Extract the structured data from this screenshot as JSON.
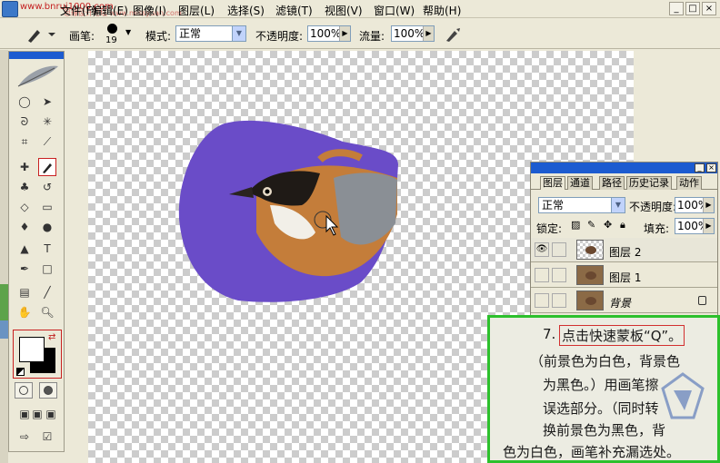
{
  "watermark": "www.bnrui1000.com",
  "watermark_sub": "思缘设计论坛 www.missyuan.com",
  "menus": [
    "文件(F)",
    "编辑(E)",
    "图像(I)",
    "图层(L)",
    "选择(S)",
    "滤镜(T)",
    "视图(V)",
    "窗口(W)",
    "帮助(H)"
  ],
  "window_controls": [
    "_",
    "□",
    "×"
  ],
  "options": {
    "brush_label": "画笔:",
    "brush_size": "19",
    "mode_label": "模式:",
    "mode_value": "正常",
    "opacity_label": "不透明度:",
    "opacity_value": "100%",
    "flow_label": "流量:",
    "flow_value": "100%"
  },
  "layers_panel": {
    "tabs": [
      "图层",
      "通道",
      "路径",
      "历史记录",
      "动作"
    ],
    "blend_mode": "正常",
    "opacity_label": "不透明度:",
    "opacity_value": "100%",
    "lock_label": "锁定:",
    "fill_label": "填充:",
    "fill_value": "100%",
    "layers": [
      {
        "name": "图层 2",
        "visible": true
      },
      {
        "name": "图层 1",
        "visible": false
      },
      {
        "name": "背景",
        "visible": false,
        "locked": true
      }
    ]
  },
  "note": {
    "step": "7.",
    "highlight": "点击快速蒙板“Q”。",
    "lines": [
      "（前景色为白色，背景色",
      "为黑色。）用画笔擦",
      "误选部分。（同时转",
      "换前景色为黑色，背",
      "色为白色，画笔补充漏选处。"
    ]
  },
  "colors": {
    "mask_purple": "#6a4cc8",
    "titlebar_blue": "#1c5bd0",
    "note_border": "#2dc02d",
    "highlight_red": "#d23030"
  }
}
